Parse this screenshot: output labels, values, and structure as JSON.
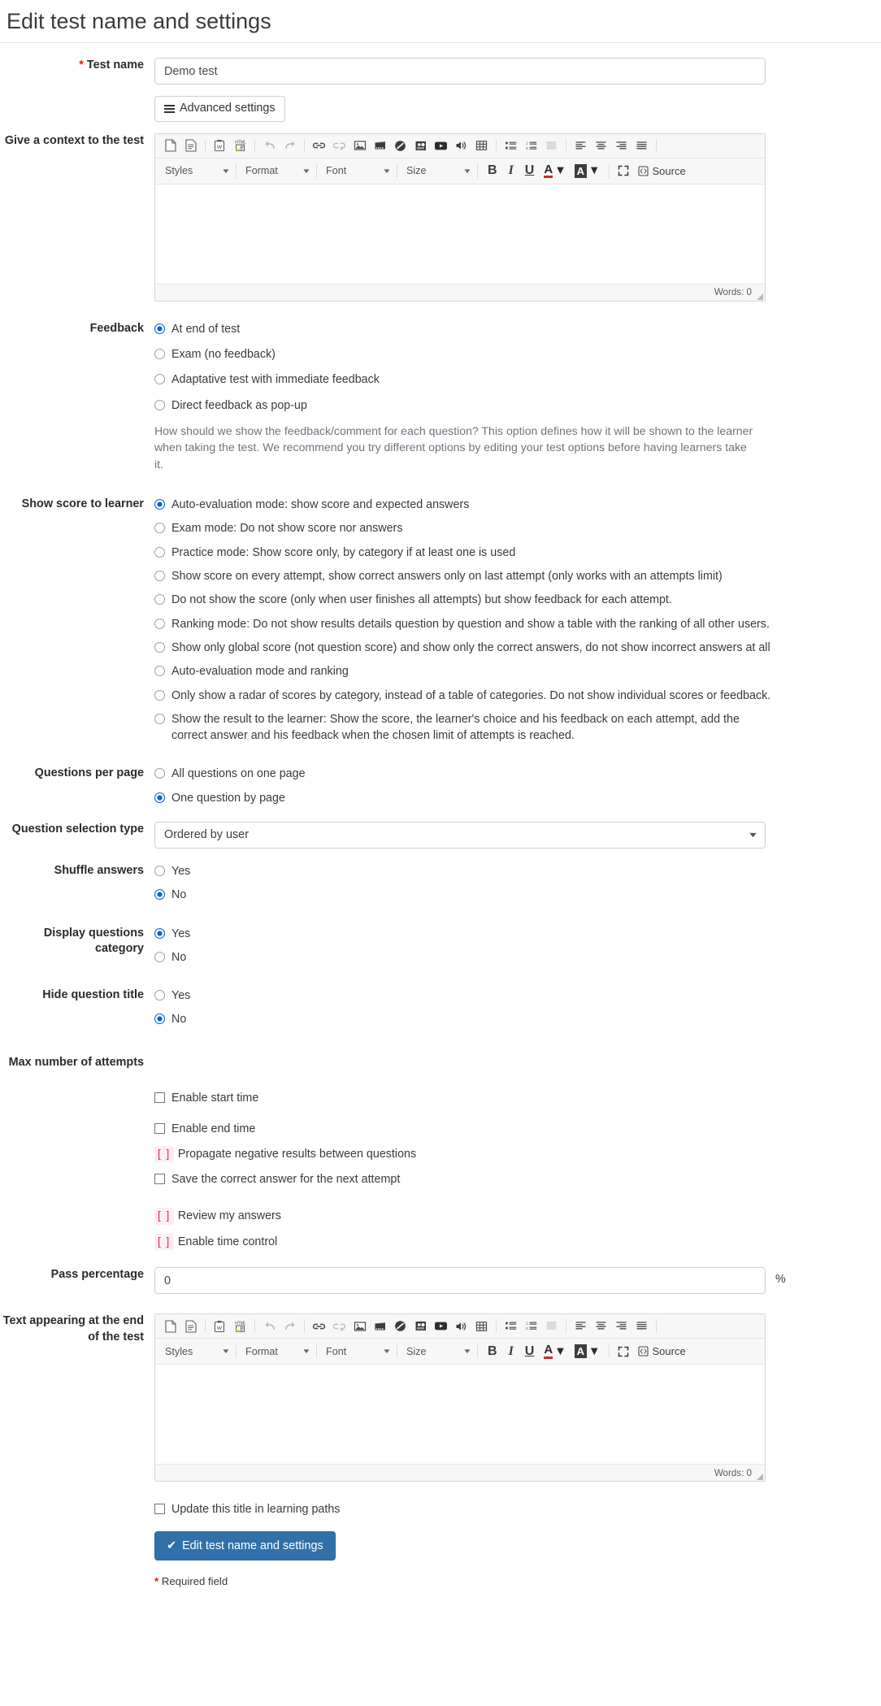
{
  "page": {
    "title": "Edit test name and settings",
    "required_note": "* Required field",
    "required_star": "*"
  },
  "test_name": {
    "label": "Test name",
    "value": "Demo test",
    "placeholder": ""
  },
  "advanced_settings": {
    "label": "Advanced settings"
  },
  "context": {
    "label": "Give a context to the test",
    "words": "Words: 0"
  },
  "editor_toolbar": {
    "row1": [
      "new-page-icon",
      "templates-icon",
      "paste-from-word-icon",
      "paste-from-html-icon",
      "undo-icon",
      "redo-icon",
      "link-icon",
      "unlink-icon",
      "image-icon",
      "flash-icon",
      "iframe-icon",
      "audio-record-icon",
      "video-icon",
      "sound-icon",
      "table-icon",
      "bulleted-list-icon",
      "numbered-list-icon",
      "justify-block-icon",
      "align-left-icon",
      "align-center-icon",
      "align-right-icon",
      "align-justify-icon"
    ],
    "styles_label": "Styles",
    "format_label": "Format",
    "font_label": "Font",
    "size_label": "Size",
    "bold_label": "B",
    "italic_label": "I",
    "underline_label": "U",
    "textcolor_label": "A",
    "bgcolor_label": "A",
    "maximize_icon": "maximize-icon",
    "source_label": "Source"
  },
  "feedback": {
    "label": "Feedback",
    "options": [
      {
        "text": "At end of test",
        "selected": true
      },
      {
        "text": "Exam (no feedback)",
        "selected": false
      },
      {
        "text": "Adaptative test with immediate feedback",
        "selected": false
      },
      {
        "text": "Direct feedback as pop-up",
        "selected": false
      }
    ],
    "hint": "How should we show the feedback/comment for each question? This option defines how it will be shown to the learner when taking the test. We recommend you try different options by editing your test options before having learners take it."
  },
  "show_score": {
    "label": "Show score to learner",
    "options": [
      {
        "text": "Auto-evaluation mode: show score and expected answers",
        "selected": true
      },
      {
        "text": "Exam mode: Do not show score nor answers",
        "selected": false
      },
      {
        "text": "Practice mode: Show score only, by category if at least one is used",
        "selected": false
      },
      {
        "text": "Show score on every attempt, show correct answers only on last attempt (only works with an attempts limit)",
        "selected": false
      },
      {
        "text": "Do not show the score (only when user finishes all attempts) but show feedback for each attempt.",
        "selected": false
      },
      {
        "text": "Ranking mode: Do not show results details question by question and show a table with the ranking of all other users.",
        "selected": false
      },
      {
        "text": "Show only global score (not question score) and show only the correct answers, do not show incorrect answers at all",
        "selected": false
      },
      {
        "text": "Auto-evaluation mode and ranking",
        "selected": false
      },
      {
        "text": "Only show a radar of scores by category, instead of a table of categories. Do not show individual scores or feedback.",
        "selected": false
      },
      {
        "text": "Show the result to the learner: Show the score, the learner's choice and his feedback on each attempt, add the correct answer and his feedback when the chosen limit of attempts is reached.",
        "selected": false
      }
    ]
  },
  "questions_per_page": {
    "label": "Questions per page",
    "options": [
      {
        "text": "All questions on one page",
        "selected": false
      },
      {
        "text": "One question by page",
        "selected": true
      }
    ]
  },
  "question_selection": {
    "label": "Question selection type",
    "value": "Ordered by user"
  },
  "shuffle_answers": {
    "label": "Shuffle answers",
    "options": [
      {
        "text": "Yes",
        "selected": false
      },
      {
        "text": "No",
        "selected": true
      }
    ]
  },
  "display_questions_category": {
    "label": "Display questions category",
    "options": [
      {
        "text": "Yes",
        "selected": true
      },
      {
        "text": "No",
        "selected": false
      }
    ]
  },
  "hide_question_title": {
    "label": "Hide question title",
    "options": [
      {
        "text": "Yes",
        "selected": false
      },
      {
        "text": "No",
        "selected": true
      }
    ]
  },
  "max_attempts": {
    "label": "Max number of attempts"
  },
  "toggles": [
    {
      "type": "checkbox",
      "text": "Enable start time",
      "checked": false
    },
    {
      "type": "checkbox",
      "text": "Enable end time",
      "checked": false
    },
    {
      "type": "raw",
      "marker": "[ ]",
      "text": "Propagate negative results between questions"
    },
    {
      "type": "checkbox",
      "text": "Save the correct answer for the next attempt",
      "checked": false
    },
    {
      "type": "raw",
      "marker": "[ ]",
      "text": "Review my answers"
    },
    {
      "type": "raw",
      "marker": "[ ]",
      "text": "Enable time control"
    }
  ],
  "pass_percentage": {
    "label": "Pass percentage",
    "value": "0",
    "suffix": "%"
  },
  "end_text": {
    "label": "Text appearing at the end of the test",
    "words": "Words: 0"
  },
  "update_title": {
    "text": "Update this title in learning paths",
    "checked": false
  },
  "submit": {
    "label": "Edit test name and settings",
    "check_icon": "check-icon"
  },
  "colors": {
    "accent": "#3071a9",
    "radio_on": "#0b63ce",
    "required": "#e2190f",
    "raw_marker": "#e0245e",
    "hint": "#6c757d"
  }
}
